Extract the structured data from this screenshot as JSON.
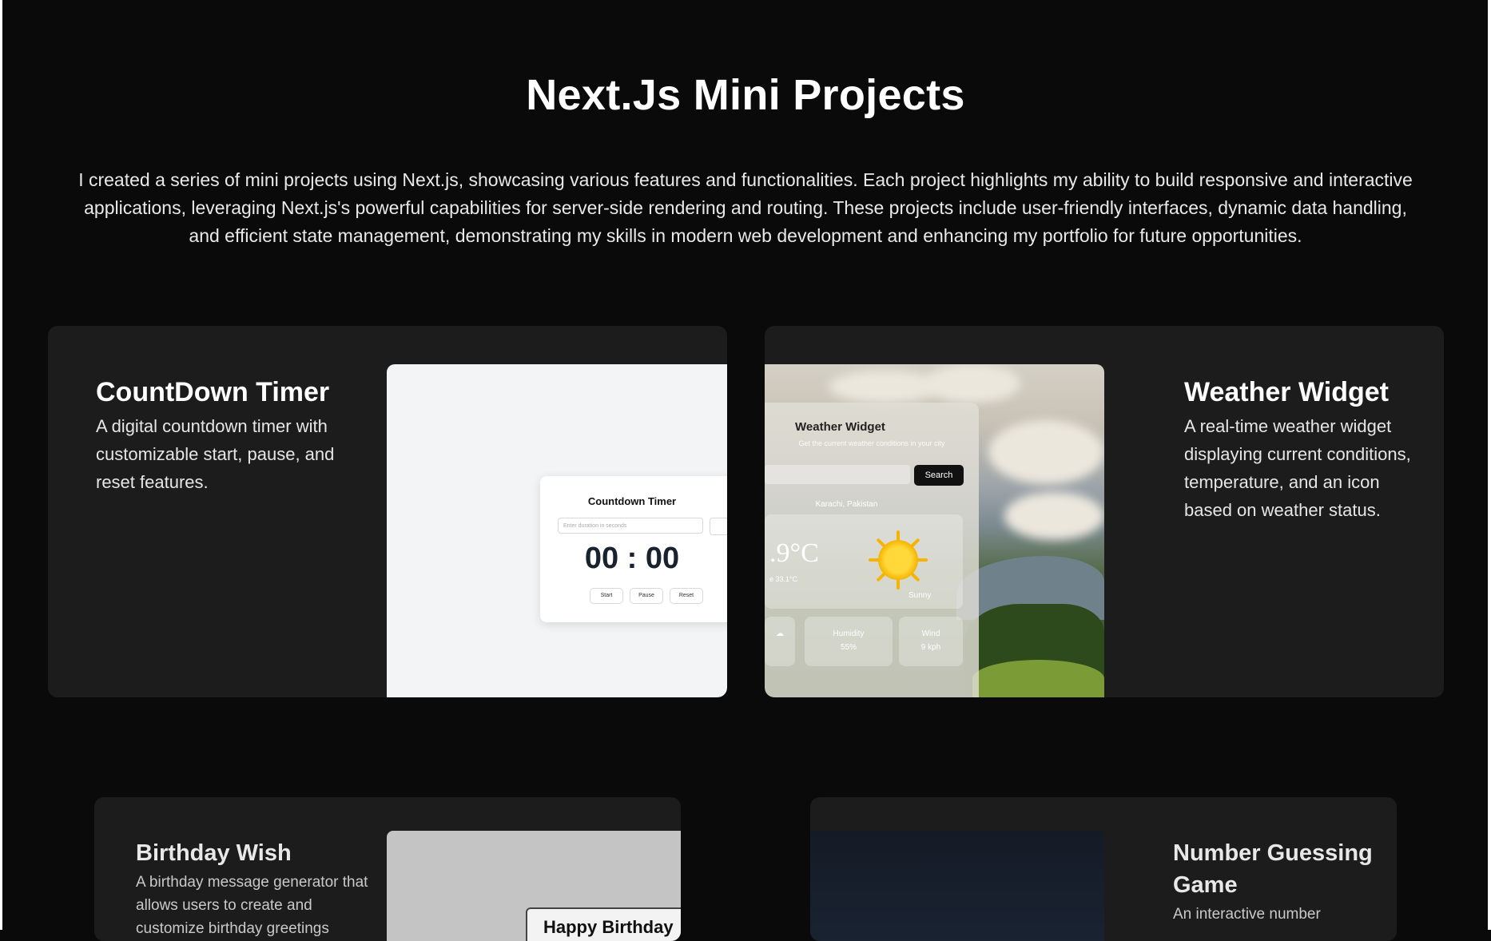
{
  "header": {
    "title": "Next.Js Mini Projects",
    "intro": "I created a series of mini projects using Next.js, showcasing various features and functionalities. Each project highlights my ability to build responsive and interactive applications, leveraging Next.js's powerful capabilities for server-side rendering and routing. These projects include user-friendly interfaces, dynamic data handling, and efficient state management, demonstrating my skills in modern web development and enhancing my portfolio for future opportunities."
  },
  "projects": [
    {
      "title": "CountDown Timer",
      "description": "A digital countdown timer with customizable start, pause, and reset features.",
      "preview": {
        "heading": "Countdown Timer",
        "input_placeholder": "Enter duration in seconds",
        "time": "00 : 00",
        "buttons": [
          "Start",
          "Pause",
          "Reset"
        ]
      }
    },
    {
      "title": "Weather Widget",
      "description": "A real-time weather widget displaying current conditions, temperature, and an icon based on weather status.",
      "preview": {
        "heading": "Weather Widget",
        "subtitle": "Get the current weather conditions in your city",
        "search_label": "Search",
        "location": "Karachi, Pakistan",
        "temperature": ".9°C",
        "feels_like": "e 33.1°C",
        "condition": "Sunny",
        "humidity_label": "Humidity",
        "humidity_value": "55%",
        "wind_label": "Wind",
        "wind_value": "9 kph"
      }
    },
    {
      "title": "Birthday Wish",
      "description": "A birthday message generator that allows users to create and customize birthday greetings",
      "preview": {
        "card_text": "Happy Birthday"
      }
    },
    {
      "title": "Number Guessing Game",
      "description": "An interactive number"
    }
  ]
}
